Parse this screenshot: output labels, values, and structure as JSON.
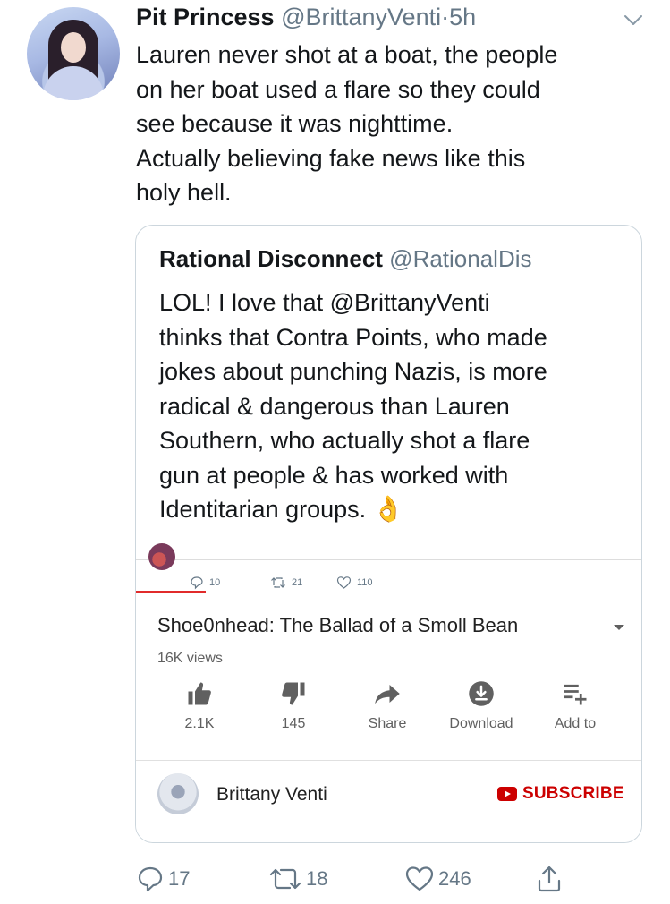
{
  "tweet": {
    "author_name": "Pit Princess",
    "author_handle": "@BrittanyVenti",
    "separator": "·",
    "time": "5h",
    "text": "Lauren never shot at a boat, the people\non her boat used a flare so they could\nsee because it was nighttime.\nActually believing fake news like this\nholy hell.",
    "actions": {
      "replies": "17",
      "retweets": "18",
      "likes": "246"
    }
  },
  "quoted": {
    "author_name": "Rational Disconnect",
    "author_handle": "@RationalDis",
    "text": "LOL! I love that @BrittanyVenti\nthinks that Contra Points, who made\njokes about punching Nazis, is more\nradical & dangerous than Lauren\nSouthern, who actually shot a flare\ngun at people & has worked with\nIdentitarian groups.",
    "emoji": "👌",
    "media": {
      "mini_stats": {
        "replies": "10",
        "retweets": "21",
        "likes": "110"
      },
      "video_title": "Shoe0nhead: The Ballad of a Smoll Bean",
      "views": "16K views",
      "actions": [
        {
          "icon": "thumbs-up-icon",
          "label": "2.1K"
        },
        {
          "icon": "thumbs-down-icon",
          "label": "145"
        },
        {
          "icon": "share-arrow-icon",
          "label": "Share"
        },
        {
          "icon": "download-icon",
          "label": "Download"
        },
        {
          "icon": "playlist-add-icon",
          "label": "Add to"
        }
      ],
      "channel_name": "Brittany Venti",
      "subscribe_label": "SUBSCRIBE",
      "accent_color": "#cc0000"
    }
  },
  "colors": {
    "text": "#14171a",
    "secondary": "#657786",
    "border": "#ccd6dd",
    "youtube_red": "#e12b2b"
  }
}
